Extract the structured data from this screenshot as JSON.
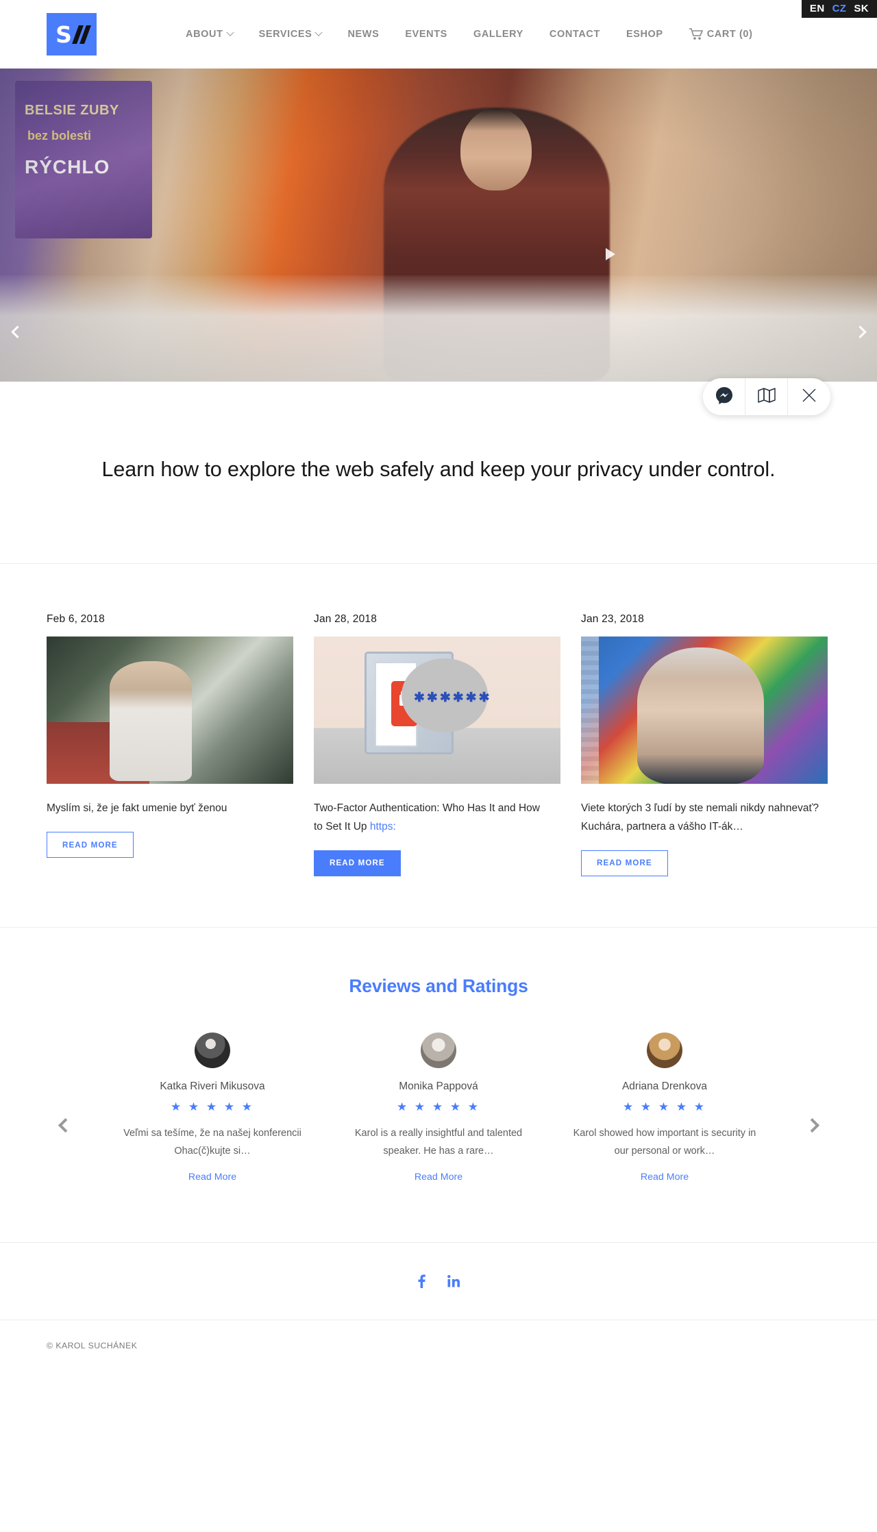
{
  "langbar": {
    "items": [
      {
        "code": "EN",
        "active": false
      },
      {
        "code": "CZ",
        "active": true
      },
      {
        "code": "SK",
        "active": false
      }
    ]
  },
  "header": {
    "logo": {
      "letter": "S",
      "name": "karol-suchanek-logo"
    },
    "nav": [
      {
        "label": "ABOUT",
        "has_dropdown": true
      },
      {
        "label": "SERVICES",
        "has_dropdown": true
      },
      {
        "label": "NEWS",
        "has_dropdown": false
      },
      {
        "label": "EVENTS",
        "has_dropdown": false
      },
      {
        "label": "GALLERY",
        "has_dropdown": false
      },
      {
        "label": "CONTACT",
        "has_dropdown": false
      },
      {
        "label": "ESHOP",
        "has_dropdown": false
      }
    ],
    "cart_label": "CART (0)"
  },
  "hero": {
    "sign_line1": "BELSIE ZUBY",
    "sign_line2": "bez bolesti",
    "sign_line3": "RÝCHLO",
    "prev_label": "‹",
    "next_label": "›"
  },
  "widget": {
    "messenger_label": "messenger-icon",
    "map_label": "map-icon",
    "close_label": "×"
  },
  "headline": {
    "text": "Learn how to explore the web safely and keep your privacy under control."
  },
  "news": {
    "cards": [
      {
        "date": "Feb 6, 2018",
        "title": "Myslím si, že je fakt umenie byť ženou",
        "link_text": "",
        "button": "READ MORE",
        "button_style": "outline"
      },
      {
        "date": "Jan 28, 2018",
        "title": "Two-Factor Authentication: Who Has It and How to Set It Up ",
        "link_text": "https:",
        "button": "READ MORE",
        "button_style": "filled"
      },
      {
        "date": "Jan 23, 2018",
        "title": "Viete ktorých 3 ľudí by ste nemali nikdy nahnevať? Kuchára, partnera a vášho IT-ák…",
        "link_text": "",
        "button": "READ MORE",
        "button_style": "outline"
      }
    ]
  },
  "reviews": {
    "title": "Reviews and Ratings",
    "prev_label": "‹",
    "next_label": "›",
    "items": [
      {
        "name": "Katka Riveri Mikusova",
        "stars": "★ ★ ★ ★ ★",
        "rating": 5,
        "text": "Veľmi sa tešíme, že na našej konferencii Ohac(č)kujte si…",
        "read_more": "Read More"
      },
      {
        "name": "Monika Pappová",
        "stars": "★ ★ ★ ★ ★",
        "rating": 5,
        "text": "Karol is a really insightful and talented speaker. He has a rare…",
        "read_more": "Read More"
      },
      {
        "name": "Adriana Drenkova",
        "stars": "★ ★ ★ ★ ★",
        "rating": 5,
        "text": "Karol showed how important is security in our personal or work…",
        "read_more": "Read More"
      }
    ]
  },
  "social": {
    "facebook": "f",
    "linkedin": "in"
  },
  "footer": {
    "copyright": "© KAROL SUCHÁNEK"
  },
  "colors": {
    "accent": "#4a7dfc",
    "logo_bg": "#4a7dfc",
    "nav_text": "#8a8a8a",
    "langbar_bg": "#1b1b1b",
    "star": "#4a7dfc"
  }
}
